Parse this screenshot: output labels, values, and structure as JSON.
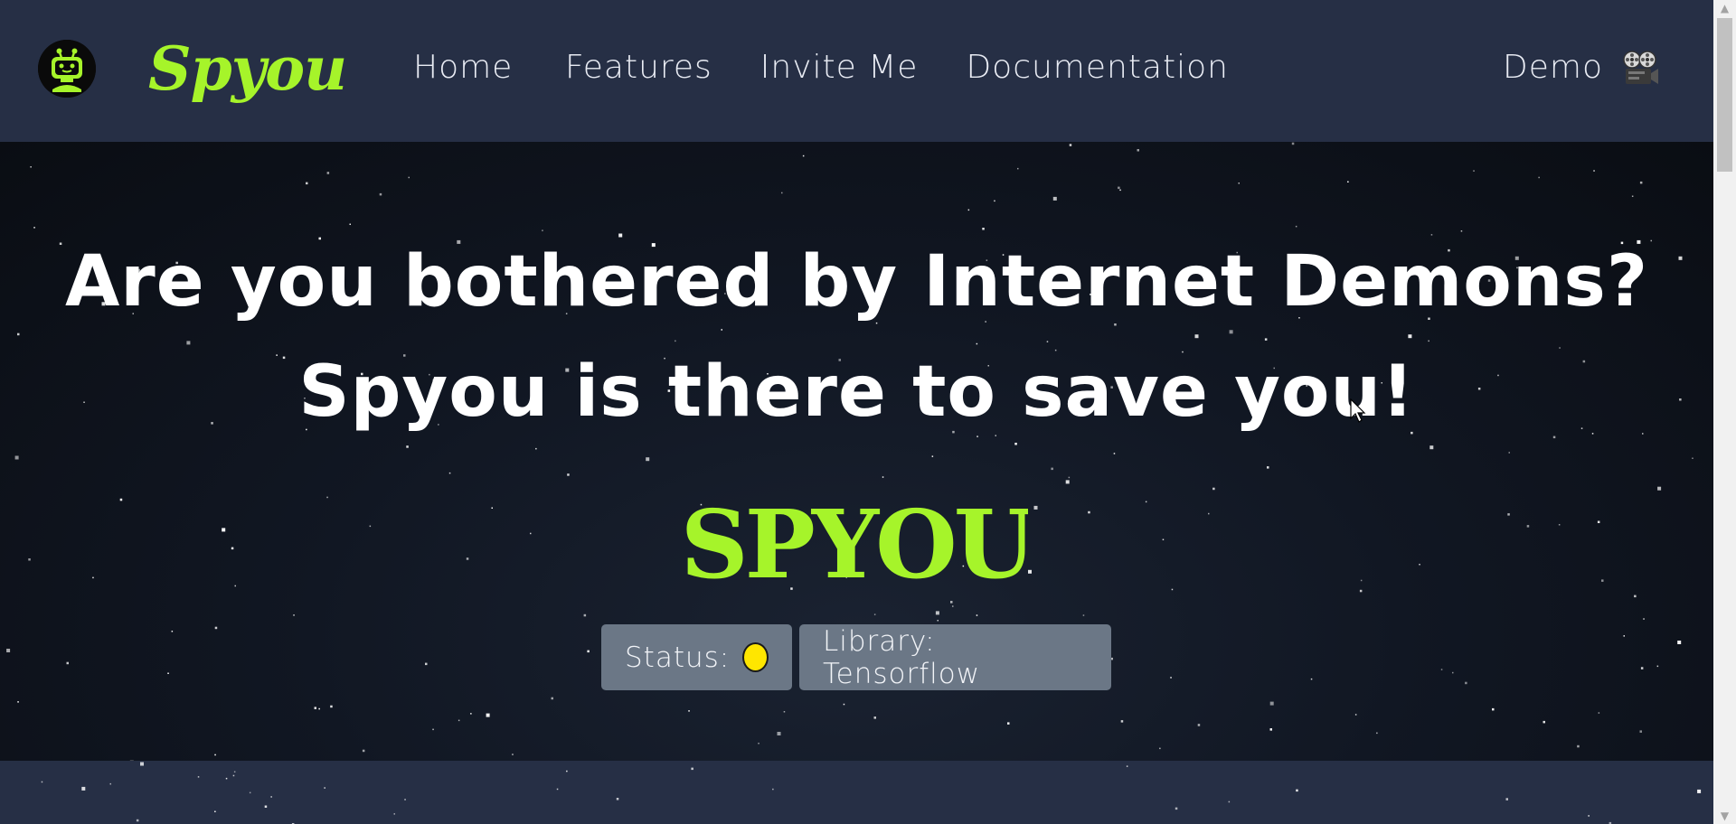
{
  "navbar": {
    "brand": "Spyou",
    "links": [
      {
        "label": "Home"
      },
      {
        "label": "Features"
      },
      {
        "label": "Invite Me"
      },
      {
        "label": "Documentation"
      }
    ],
    "demo_label": "Demo",
    "demo_icon": "film-projector-icon",
    "logo_icon": "robot-icon",
    "brand_color": "#a6f42a",
    "bg_color": "#262f45"
  },
  "hero": {
    "headline_1": "Are you bothered by Internet Demons?",
    "headline_2": "Spyou is there to save you!",
    "logo_text": "SPYOU",
    "status_label": "Status:",
    "status_color": "#ffe600",
    "library_label": "Library: Tensorflow"
  }
}
